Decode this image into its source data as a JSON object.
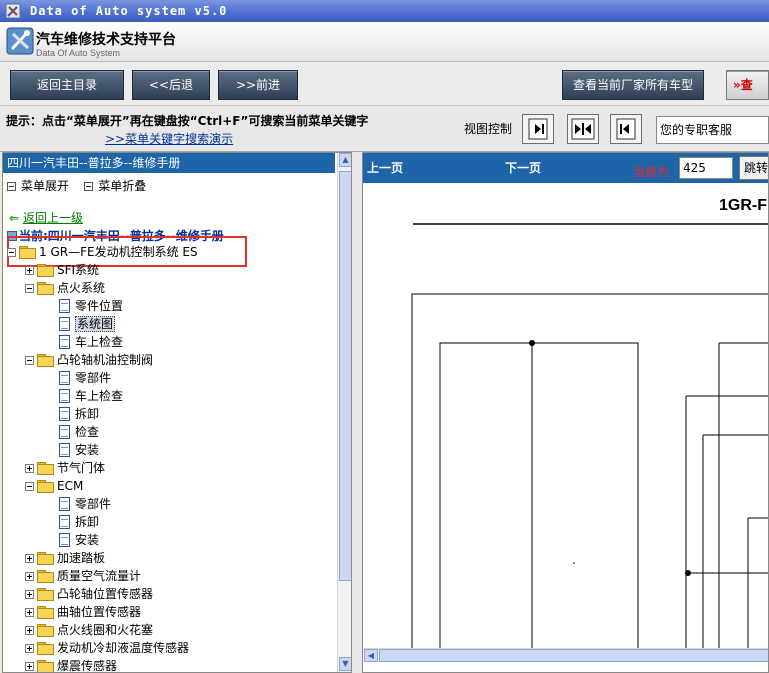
{
  "window": {
    "title": "Data of Auto system v5.0"
  },
  "header": {
    "title_cn": "汽车维修技术支持平台",
    "title_en": "Data Of Auto System"
  },
  "toolbar": {
    "back_main": "返回主目录",
    "back": "<<后退",
    "forward": ">>前进",
    "view_all_models": "查看当前厂家所有车型",
    "query": "查"
  },
  "hint": {
    "text": "提示：点击“菜单展开”再在键盘按“Ctrl+F”可搜索当前菜单关键字",
    "demo_link": ">>菜单关键字搜索演示",
    "view_control": "视图控制",
    "customer_service": "您的专职客服"
  },
  "left": {
    "breadcrumb": "四川一汽丰田--普拉多--维修手册",
    "expand_menu": "菜单展开",
    "collapse_menu": "菜单折叠",
    "back_up": "返回上一级",
    "current": "当前:四川一汽丰田--普拉多--维修手册",
    "tree": [
      {
        "label": "1 GR—FE发动机控制系统 ES",
        "type": "folder",
        "level": 0,
        "expanded": true
      },
      {
        "label": "SFI系统",
        "type": "folder",
        "level": 1,
        "expanded": false
      },
      {
        "label": "点火系统",
        "type": "folder",
        "level": 1,
        "expanded": true
      },
      {
        "label": "零件位置",
        "type": "doc",
        "level": 2
      },
      {
        "label": "系统图",
        "type": "doc",
        "level": 2,
        "selected": true
      },
      {
        "label": "车上检查",
        "type": "doc",
        "level": 2
      },
      {
        "label": "凸轮轴机油控制阀",
        "type": "folder",
        "level": 1,
        "expanded": true
      },
      {
        "label": "零部件",
        "type": "doc",
        "level": 2
      },
      {
        "label": "车上检查",
        "type": "doc",
        "level": 2
      },
      {
        "label": "拆卸",
        "type": "doc",
        "level": 2
      },
      {
        "label": "检查",
        "type": "doc",
        "level": 2
      },
      {
        "label": "安装",
        "type": "doc",
        "level": 2
      },
      {
        "label": "节气门体",
        "type": "folder",
        "level": 1,
        "expanded": false
      },
      {
        "label": "ECM",
        "type": "folder",
        "level": 1,
        "expanded": true
      },
      {
        "label": "零部件",
        "type": "doc",
        "level": 2
      },
      {
        "label": "拆卸",
        "type": "doc",
        "level": 2
      },
      {
        "label": "安装",
        "type": "doc",
        "level": 2
      },
      {
        "label": "加速踏板",
        "type": "folder",
        "level": 1,
        "expanded": false
      },
      {
        "label": "质量空气流量计",
        "type": "folder",
        "level": 1,
        "expanded": false
      },
      {
        "label": "凸轮轴位置传感器",
        "type": "folder",
        "level": 1,
        "expanded": false
      },
      {
        "label": "曲轴位置传感器",
        "type": "folder",
        "level": 1,
        "expanded": false
      },
      {
        "label": "点火线圈和火花塞",
        "type": "folder",
        "level": 1,
        "expanded": false
      },
      {
        "label": "发动机冷却液温度传感器",
        "type": "folder",
        "level": 1,
        "expanded": false
      },
      {
        "label": "爆震传感器",
        "type": "folder",
        "level": 1,
        "expanded": false
      }
    ]
  },
  "right": {
    "prev_page": "上一页",
    "next_page": "下一页",
    "current_label": "当前为",
    "page_value": "425",
    "jump": "跳转",
    "diagram_title": "1GR-F"
  },
  "colors": {
    "nav_blue": "#1e64a8",
    "highlight_red": "#e03030"
  }
}
